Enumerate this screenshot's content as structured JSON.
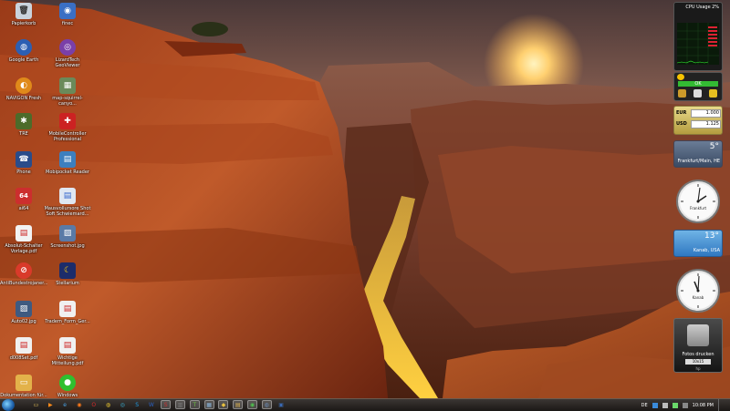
{
  "desktop_icons": [
    {
      "label": "Papierkorb",
      "icon": "recycle-bin-icon",
      "color": "#c9d3dd",
      "glyph": "🗑"
    },
    {
      "label": "finec",
      "icon": "finec-app-icon",
      "color": "#3a6fc4",
      "glyph": "◉"
    },
    {
      "label": "Google Earth",
      "icon": "google-earth-icon",
      "color": "#2c5fb3",
      "glyph": "◍"
    },
    {
      "label": "LizardTech GeoViewer",
      "icon": "geoviewer-icon",
      "color": "#7a3fa8",
      "glyph": "◎"
    },
    {
      "label": "NAVIGON Fresh",
      "icon": "navigon-icon",
      "color": "#e08a1a",
      "glyph": "◐"
    },
    {
      "label": "map-squirrel-canyo...",
      "icon": "map-file-icon",
      "color": "#6a8a5a",
      "glyph": "▦"
    },
    {
      "label": "TRE",
      "icon": "tre-app-icon",
      "color": "#4c6b2a",
      "glyph": "✱"
    },
    {
      "label": "MobileController Professional",
      "icon": "mobilecontroller-icon",
      "color": "#cc2222",
      "glyph": "✚"
    },
    {
      "label": "Phone",
      "icon": "phone-icon",
      "color": "#2a4c8a",
      "glyph": "☎"
    },
    {
      "label": "Mobipocket Reader",
      "icon": "mobipocket-icon",
      "color": "#3d7fbf",
      "glyph": "▤"
    },
    {
      "label": "ai64",
      "icon": "ai64-icon",
      "color": "#cc2e2e",
      "glyph": "64"
    },
    {
      "label": "Mausvollursore Shot Soft Schwiemard...",
      "icon": "document-icon",
      "color": "#dfe7f2",
      "glyph": "▤"
    },
    {
      "label": "Absolut-Schalter Vorlage.pdf",
      "icon": "pdf-file-icon",
      "color": "#f2f2f2",
      "glyph": "▤"
    },
    {
      "label": "Screenshot.jpg",
      "icon": "image-file-icon",
      "color": "#5a7aa6",
      "glyph": "▨"
    },
    {
      "label": "AntiBundestrojaner...",
      "icon": "antitrojaner-icon",
      "color": "#d93a2a",
      "glyph": "⊘"
    },
    {
      "label": "Stellarium",
      "icon": "stellarium-icon",
      "color": "#1c2c6a",
      "glyph": "☾"
    },
    {
      "label": "Auto02.jpg",
      "icon": "image-file-icon",
      "color": "#3f5a80",
      "glyph": "▨"
    },
    {
      "label": "Tradem_Form_Ger...",
      "icon": "pdf-file-icon",
      "color": "#f0f0f0",
      "glyph": "▤"
    },
    {
      "label": "d008Set.pdf",
      "icon": "pdf-file-icon",
      "color": "#f0f0f0",
      "glyph": "▤"
    },
    {
      "label": "Wichtige Mitteilung.pdf",
      "icon": "pdf-file-icon",
      "color": "#f0f0f0",
      "glyph": "▤"
    },
    {
      "label": "Dokumentation für...",
      "icon": "folder-icon",
      "color": "#e3b24a",
      "glyph": "▭"
    },
    {
      "label": "Windows",
      "icon": "windows-orb-icon",
      "color": "#2fbf2f",
      "glyph": "●"
    }
  ],
  "gadgets": {
    "cpu": {
      "title": "CPU Usage",
      "percent": "2%"
    },
    "norton": {
      "status": "OK"
    },
    "currency": {
      "rows": [
        {
          "code": "EUR",
          "value": "1.000"
        },
        {
          "code": "USD",
          "value": "1.125"
        }
      ]
    },
    "weather_frankfurt": {
      "temp": "5°",
      "city": "Frankfurt/Main, HE"
    },
    "weather_kanab": {
      "temp": "13°",
      "city": "Kanab, USA"
    },
    "clock_frankfurt": {
      "city": "Frankfurt"
    },
    "clock_kanab": {
      "city": "Kanab"
    },
    "printer": {
      "label": "Fotos drucken",
      "size": "10x15",
      "brand": "hp"
    }
  },
  "taskbar": {
    "buttons": [
      {
        "icon": "explorer-icon",
        "color": "#e8c45a",
        "glyph": "▭"
      },
      {
        "icon": "media-player-icon",
        "color": "#ff8c1a",
        "glyph": "▶"
      },
      {
        "icon": "ie-icon",
        "color": "#4aa3e6",
        "glyph": "e"
      },
      {
        "icon": "firefox-icon",
        "color": "#ff7a1a",
        "glyph": "◉"
      },
      {
        "icon": "opera-icon",
        "color": "#d42a2a",
        "glyph": "O"
      },
      {
        "icon": "chrome-icon",
        "color": "#e6c230",
        "glyph": "◍"
      },
      {
        "icon": "maps-icon",
        "color": "#3bb3d9",
        "glyph": "◎"
      },
      {
        "icon": "skype-icon",
        "color": "#1e9be6",
        "glyph": "S"
      },
      {
        "icon": "word-icon",
        "color": "#2a5fbf",
        "glyph": "W"
      },
      {
        "icon": "app-red-icon",
        "color": "#cc3030",
        "glyph": "S"
      },
      {
        "icon": "tool-icon",
        "color": "#7a7a7a",
        "glyph": "▥"
      },
      {
        "icon": "text-editor-icon",
        "color": "#6abf40",
        "glyph": "T"
      },
      {
        "icon": "network-icon",
        "color": "#8ab3d9",
        "glyph": "▦"
      },
      {
        "icon": "paint-icon",
        "color": "#e6c040",
        "glyph": "◆"
      },
      {
        "icon": "files-icon",
        "color": "#d9b050",
        "glyph": "▤"
      },
      {
        "icon": "sync-icon",
        "color": "#4fbf4f",
        "glyph": "◉"
      },
      {
        "icon": "camera-icon",
        "color": "#6a8ab3",
        "glyph": "◍"
      },
      {
        "icon": "console-icon",
        "color": "#3a6ab3",
        "glyph": "▣"
      }
    ],
    "tray": {
      "language": "DE",
      "time": "10:08 PM"
    }
  }
}
